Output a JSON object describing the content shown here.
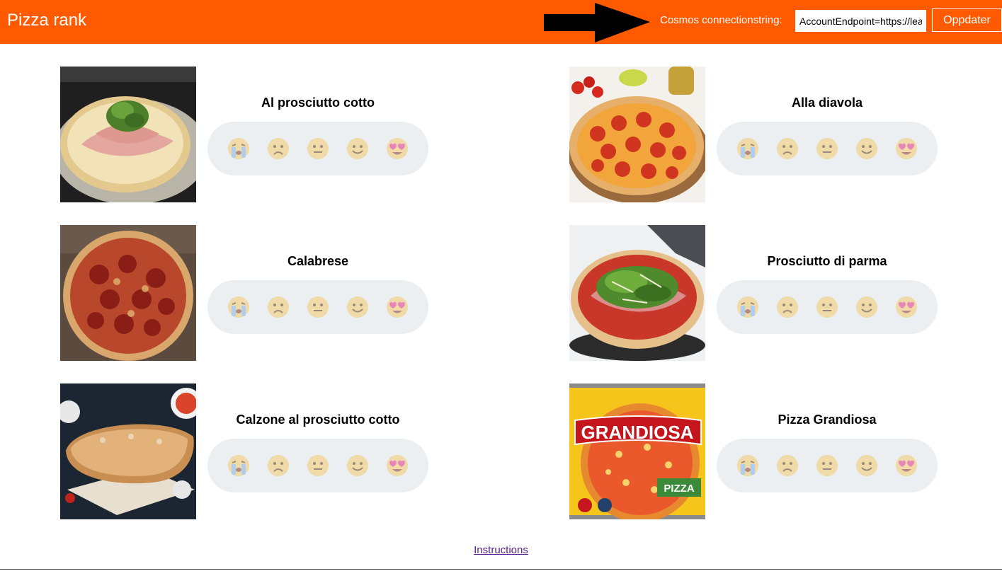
{
  "header": {
    "app_title": "Pizza rank",
    "connection_label": "Cosmos connectionstring:",
    "connection_value": "AccountEndpoint=https://lear",
    "update_label": "Oppdater",
    "brand_color": "#ff5a00"
  },
  "rating_icons": [
    "crying-face-icon",
    "sad-face-icon",
    "neutral-face-icon",
    "smiling-face-icon",
    "heart-eyes-face-icon"
  ],
  "pizzas": [
    {
      "name": "Al prosciutto cotto"
    },
    {
      "name": "Alla diavola"
    },
    {
      "name": "Calabrese"
    },
    {
      "name": "Prosciutto di parma"
    },
    {
      "name": "Calzone al prosciutto cotto"
    },
    {
      "name": "Pizza Grandiosa",
      "box_brand": "GRANDIOSA",
      "box_badge": "PIZZA"
    }
  ],
  "footer": {
    "instructions_label": "Instructions"
  }
}
